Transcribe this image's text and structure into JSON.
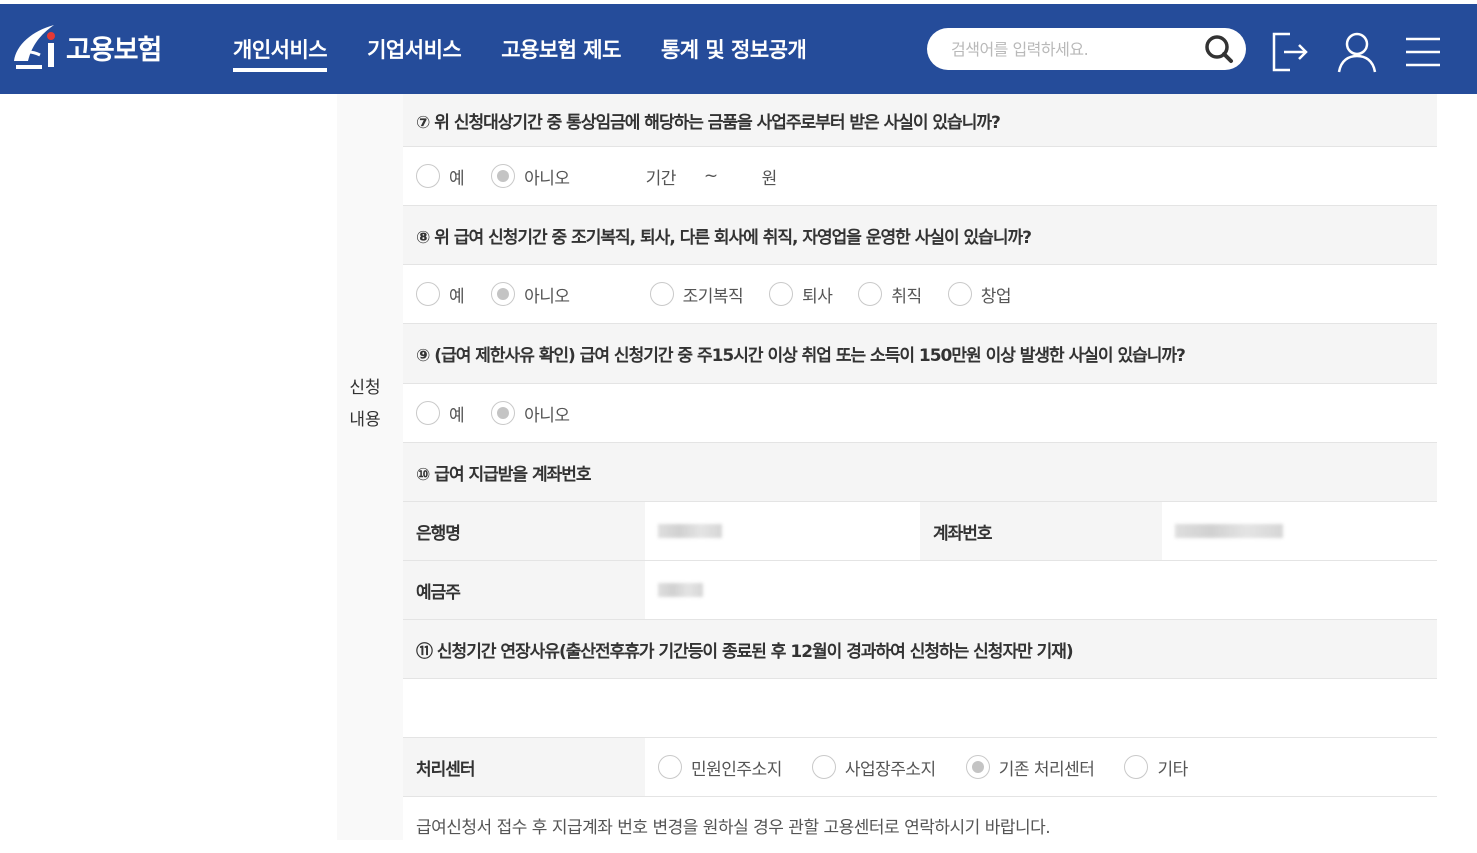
{
  "header": {
    "logo_text": "고용보험",
    "nav": [
      {
        "label": "개인서비스",
        "active": true
      },
      {
        "label": "기업서비스",
        "active": false
      },
      {
        "label": "고용보험 제도",
        "active": false
      },
      {
        "label": "통계 및 정보공개",
        "active": false
      }
    ],
    "search_placeholder": "검색어를 입력하세요.",
    "icons": [
      "search-icon",
      "logout-icon",
      "user-icon",
      "menu-icon"
    ],
    "brand_color": "#254c9a"
  },
  "section": {
    "label_line1": "신청",
    "label_line2": "내용"
  },
  "q7": {
    "question": "⑦ 위 신청대상기간 중 통상임금에 해당하는 금품을 사업주로부터 받은 사실이 있습니까?",
    "options": [
      "예",
      "아니오"
    ],
    "selected": "아니오",
    "period_label": "기간",
    "tilde": "~",
    "won": "원"
  },
  "q8": {
    "question": "⑧ 위 급여 신청기간 중 조기복직, 퇴사, 다른 회사에 취직, 자영업을 운영한 사실이 있습니까?",
    "options": [
      "예",
      "아니오"
    ],
    "selected": "아니오",
    "sub_options": [
      "조기복직",
      "퇴사",
      "취직",
      "창업"
    ]
  },
  "q9": {
    "question": "⑨ (급여 제한사유 확인) 급여 신청기간 중 주15시간 이상 취업 또는 소득이 150만원 이상 발생한 사실이 있습니까?",
    "options": [
      "예",
      "아니오"
    ],
    "selected": "아니오"
  },
  "q10": {
    "question": "⑩ 급여 지급받을 계좌번호",
    "bank_label": "은행명",
    "account_label": "계좌번호",
    "holder_label": "예금주"
  },
  "q11": {
    "question": "⑪ 신청기간 연장사유(출산전후휴가 기간등이 종료된 후 12월이 경과하여 신청하는 신청자만 기재)",
    "value": ""
  },
  "center": {
    "label": "처리센터",
    "options": [
      "민원인주소지",
      "사업장주소지",
      "기존 처리센터",
      "기타"
    ],
    "selected": "기존 처리센터"
  },
  "notice": "급여신청서 접수 후 지급계좌 번호 변경을 원하실 경우 관할 고용센터로 연락하시기 바랍니다."
}
